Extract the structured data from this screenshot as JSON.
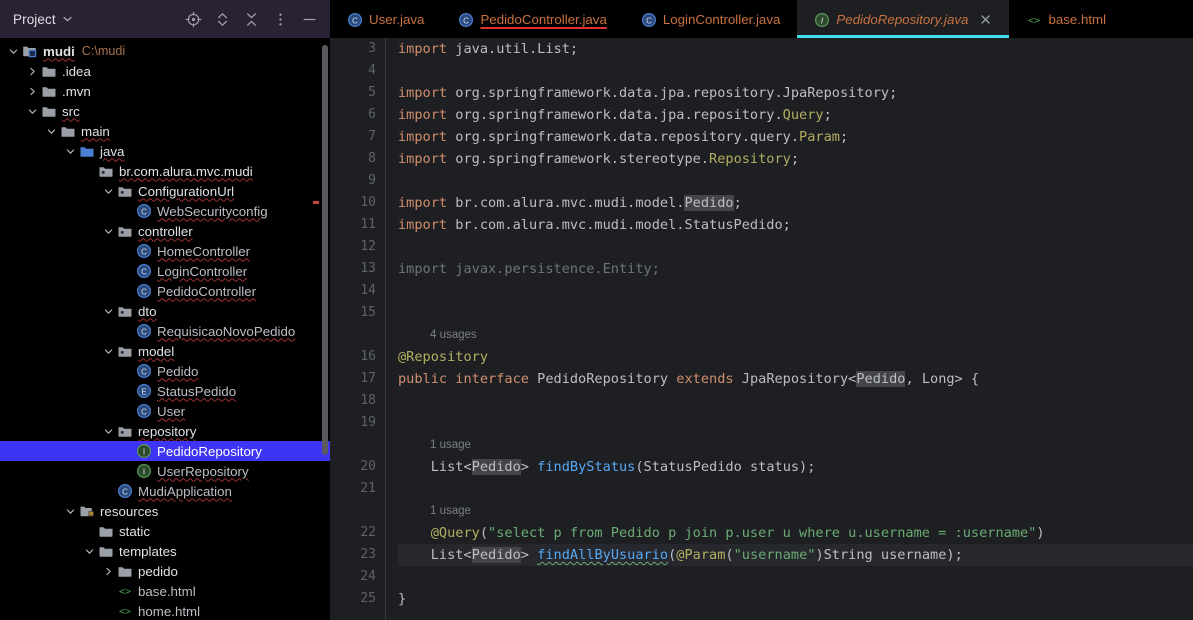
{
  "sidebar": {
    "title": "Project",
    "caret_icon": "chevron-down-icon",
    "tools": [
      {
        "name": "locate-icon",
        "label": "Select Opened File"
      },
      {
        "name": "expand-collapse-icon",
        "label": "Expand All"
      },
      {
        "name": "collapse-all-icon",
        "label": "Collapse All"
      },
      {
        "name": "more-options-icon",
        "label": "Options"
      },
      {
        "name": "minimize-icon",
        "label": "Hide"
      }
    ],
    "tree": [
      {
        "depth": 0,
        "arrow": "down",
        "icon": "project-module-icon",
        "label": "mudi",
        "style": "proj",
        "path": "C:\\mudi",
        "wavy": true
      },
      {
        "depth": 1,
        "arrow": "right",
        "icon": "folder-icon",
        "label": ".idea",
        "style": "fold"
      },
      {
        "depth": 1,
        "arrow": "right",
        "icon": "folder-icon",
        "label": ".mvn",
        "style": "fold"
      },
      {
        "depth": 1,
        "arrow": "down",
        "icon": "folder-icon",
        "label": "src",
        "style": "fold",
        "wavy": true
      },
      {
        "depth": 2,
        "arrow": "down",
        "icon": "folder-icon",
        "label": "main",
        "style": "fold",
        "wavy": true
      },
      {
        "depth": 3,
        "arrow": "down",
        "icon": "source-root-icon",
        "label": "java",
        "style": "fold",
        "wavy": true
      },
      {
        "depth": 4,
        "arrow": "",
        "icon": "package-icon",
        "label": "br.com.alura.mvc.mudi",
        "style": "pkg",
        "wavy": true
      },
      {
        "depth": 5,
        "arrow": "down",
        "icon": "package-icon",
        "label": "ConfigurationUrl",
        "style": "pkg",
        "wavy": true
      },
      {
        "depth": 6,
        "arrow": "",
        "icon": "class-icon",
        "label": "WebSecurityconfig",
        "style": "cls",
        "wavy": true
      },
      {
        "depth": 5,
        "arrow": "down",
        "icon": "package-icon",
        "label": "controller",
        "style": "pkg",
        "wavy": true
      },
      {
        "depth": 6,
        "arrow": "",
        "icon": "class-icon",
        "label": "HomeController",
        "style": "cls",
        "wavy": true
      },
      {
        "depth": 6,
        "arrow": "",
        "icon": "class-icon",
        "label": "LoginController",
        "style": "cls",
        "wavy": true
      },
      {
        "depth": 6,
        "arrow": "",
        "icon": "class-icon",
        "label": "PedidoController",
        "style": "cls",
        "wavy": true
      },
      {
        "depth": 5,
        "arrow": "down",
        "icon": "package-icon",
        "label": "dto",
        "style": "pkg",
        "wavy": true
      },
      {
        "depth": 6,
        "arrow": "",
        "icon": "class-icon",
        "label": "RequisicaoNovoPedido",
        "style": "cls",
        "wavy": true
      },
      {
        "depth": 5,
        "arrow": "down",
        "icon": "package-icon",
        "label": "model",
        "style": "pkg",
        "wavy": true
      },
      {
        "depth": 6,
        "arrow": "",
        "icon": "class-icon",
        "label": "Pedido",
        "style": "cls",
        "wavy": true
      },
      {
        "depth": 6,
        "arrow": "",
        "icon": "enum-icon",
        "label": "StatusPedido",
        "style": "cls",
        "wavy": true
      },
      {
        "depth": 6,
        "arrow": "",
        "icon": "class-icon",
        "label": "User",
        "style": "cls",
        "wavy": true
      },
      {
        "depth": 5,
        "arrow": "down",
        "icon": "package-icon",
        "label": "repository",
        "style": "pkg",
        "wavy": true
      },
      {
        "depth": 6,
        "arrow": "",
        "icon": "interface-icon",
        "label": "PedidoRepository",
        "style": "cls",
        "selected": true
      },
      {
        "depth": 6,
        "arrow": "",
        "icon": "interface-icon",
        "label": "UserRepository",
        "style": "cls",
        "wavy": true
      },
      {
        "depth": 5,
        "arrow": "",
        "icon": "class-icon",
        "label": "MudiApplication",
        "style": "cls",
        "wavy": true
      },
      {
        "depth": 3,
        "arrow": "down",
        "icon": "resource-root-icon",
        "label": "resources",
        "style": "fold"
      },
      {
        "depth": 4,
        "arrow": "",
        "icon": "folder-icon",
        "label": "static",
        "style": "fold"
      },
      {
        "depth": 4,
        "arrow": "down",
        "icon": "folder-icon",
        "label": "templates",
        "style": "fold"
      },
      {
        "depth": 5,
        "arrow": "right",
        "icon": "folder-icon",
        "label": "pedido",
        "style": "fold"
      },
      {
        "depth": 5,
        "arrow": "",
        "icon": "html-icon",
        "label": "base.html",
        "style": "cls"
      },
      {
        "depth": 5,
        "arrow": "",
        "icon": "html-icon",
        "label": "home.html",
        "style": "cls"
      }
    ]
  },
  "tabs": [
    {
      "label": "User.java",
      "icon": "class-icon",
      "active": false,
      "modified": false,
      "closable": false
    },
    {
      "label": "PedidoController.java",
      "icon": "class-icon",
      "active": false,
      "modified": true,
      "closable": false
    },
    {
      "label": "LoginController.java",
      "icon": "class-icon",
      "active": false,
      "modified": false,
      "closable": false
    },
    {
      "label": "PedidoRepository.java",
      "icon": "interface-icon",
      "active": true,
      "modified": false,
      "closable": true
    },
    {
      "label": "base.html",
      "icon": "html-icon",
      "active": false,
      "modified": false,
      "closable": false
    }
  ],
  "tab_close_icon": "close-icon",
  "editor": {
    "first_line": 3,
    "current_line": 23,
    "lines": [
      {
        "n": 3,
        "tokens": [
          {
            "t": "import ",
            "c": "kw"
          },
          {
            "t": "java.util.List;",
            "c": "id"
          }
        ]
      },
      {
        "n": 4,
        "tokens": []
      },
      {
        "n": 5,
        "tokens": [
          {
            "t": "import ",
            "c": "kw"
          },
          {
            "t": "org.springframework.data.jpa.repository.",
            "c": "id"
          },
          {
            "t": "JpaRepository",
            "c": "id"
          },
          {
            "t": ";",
            "c": "id"
          }
        ]
      },
      {
        "n": 6,
        "tokens": [
          {
            "t": "import ",
            "c": "kw"
          },
          {
            "t": "org.springframework.data.jpa.repository.",
            "c": "id"
          },
          {
            "t": "Query",
            "c": "ann"
          },
          {
            "t": ";",
            "c": "id"
          }
        ]
      },
      {
        "n": 7,
        "tokens": [
          {
            "t": "import ",
            "c": "kw"
          },
          {
            "t": "org.springframework.data.repository.query.",
            "c": "id"
          },
          {
            "t": "Param",
            "c": "ann"
          },
          {
            "t": ";",
            "c": "id"
          }
        ]
      },
      {
        "n": 8,
        "tokens": [
          {
            "t": "import ",
            "c": "kw"
          },
          {
            "t": "org.springframework.stereotype.",
            "c": "id"
          },
          {
            "t": "Repository",
            "c": "ann"
          },
          {
            "t": ";",
            "c": "id"
          }
        ]
      },
      {
        "n": 9,
        "tokens": []
      },
      {
        "n": 10,
        "tokens": [
          {
            "t": "import ",
            "c": "kw"
          },
          {
            "t": "br.com.alura.mvc.mudi.model.",
            "c": "id"
          },
          {
            "t": "Pedido",
            "c": "id hl"
          },
          {
            "t": ";",
            "c": "id"
          }
        ]
      },
      {
        "n": 11,
        "tokens": [
          {
            "t": "import ",
            "c": "kw"
          },
          {
            "t": "br.com.alura.mvc.mudi.model.StatusPedido;",
            "c": "id"
          }
        ]
      },
      {
        "n": 12,
        "tokens": []
      },
      {
        "n": 13,
        "tokens": [
          {
            "t": "import javax.persistence.Entity;",
            "c": "dim"
          }
        ]
      },
      {
        "n": 14,
        "tokens": []
      },
      {
        "n": 15,
        "tokens": []
      },
      {
        "n": 16,
        "hint": "4 usages",
        "tokens": [
          {
            "t": "@Repository",
            "c": "ann"
          }
        ]
      },
      {
        "n": 17,
        "tokens": [
          {
            "t": "public interface ",
            "c": "kw"
          },
          {
            "t": "PedidoRepository",
            "c": "id"
          },
          {
            "t": " extends ",
            "c": "kw"
          },
          {
            "t": "JpaRepository<",
            "c": "id"
          },
          {
            "t": "Pedido",
            "c": "id hl"
          },
          {
            "t": ", Long> {",
            "c": "id"
          }
        ]
      },
      {
        "n": 18,
        "tokens": []
      },
      {
        "n": 19,
        "tokens": []
      },
      {
        "n": 20,
        "hint": "1 usage",
        "indent": 4,
        "tokens": [
          {
            "t": "    List<",
            "c": "id"
          },
          {
            "t": "Pedido",
            "c": "id hl"
          },
          {
            "t": "> ",
            "c": "id"
          },
          {
            "t": "findByStatus",
            "c": "mth"
          },
          {
            "t": "(StatusPedido status);",
            "c": "id"
          }
        ]
      },
      {
        "n": 21,
        "tokens": []
      },
      {
        "n": 22,
        "hint": "1 usage",
        "tokens": [
          {
            "t": "    @Query",
            "c": "ann"
          },
          {
            "t": "(",
            "c": "id"
          },
          {
            "t": "\"select p from Pedido p join p.user u where u.username = :username\"",
            "c": "str"
          },
          {
            "t": ")",
            "c": "id"
          }
        ]
      },
      {
        "n": 23,
        "tokens": [
          {
            "t": "    List<",
            "c": "id"
          },
          {
            "t": "Pedido",
            "c": "id hl"
          },
          {
            "t": "> ",
            "c": "id"
          },
          {
            "t": "findAllByUsuario",
            "c": "mth sq"
          },
          {
            "t": "(",
            "c": "id"
          },
          {
            "t": "@Param",
            "c": "ann"
          },
          {
            "t": "(",
            "c": "id"
          },
          {
            "t": "\"username\"",
            "c": "str"
          },
          {
            "t": ")String username);",
            "c": "id"
          }
        ]
      },
      {
        "n": 24,
        "tokens": []
      },
      {
        "n": 25,
        "tokens": [
          {
            "t": "}",
            "c": "id"
          }
        ]
      }
    ]
  },
  "colors": {
    "sidebar_header_bg": "#2b2135",
    "sidebar_bg": "#000000",
    "editor_bg": "#1e1f22",
    "tabbar_bg": "#000000",
    "selection_blue": "#3d34f5",
    "active_tab_underline": "#3ddfe8",
    "tab_label": "#c8713f",
    "keyword": "#cf8e6d",
    "annotation": "#b3ae60",
    "string": "#6aab73",
    "method": "#56a8f5",
    "identifier": "#bcbec4",
    "dimmed": "#6f737a"
  }
}
